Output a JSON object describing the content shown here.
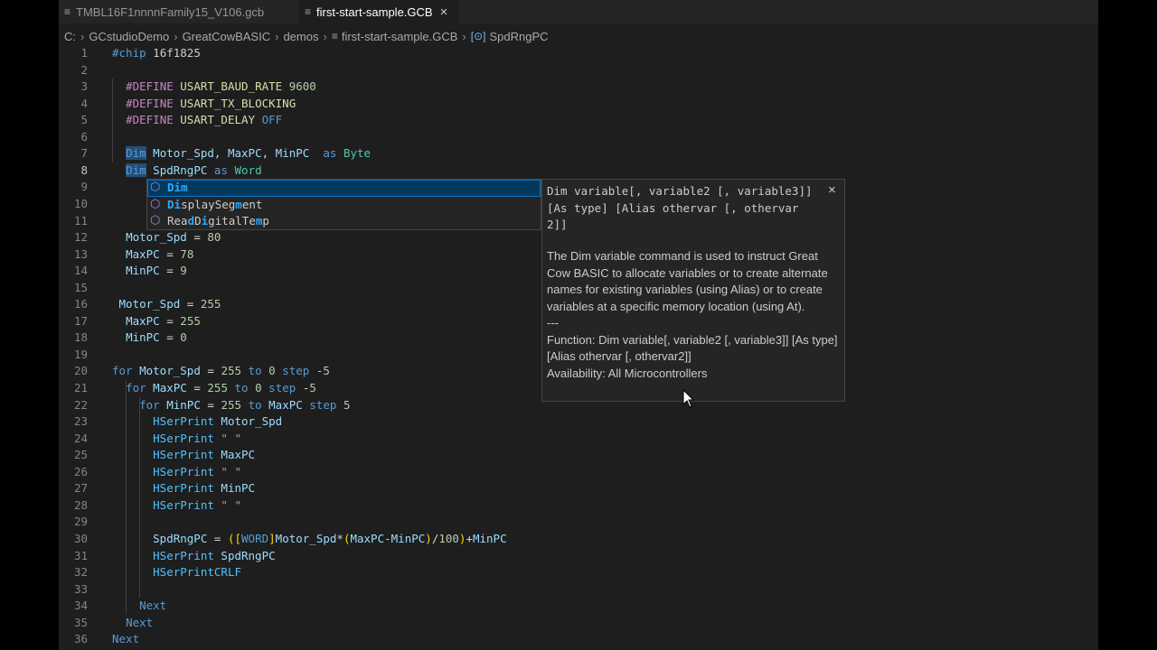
{
  "tabs": [
    {
      "label": "TMBL16F1nnnnFamily15_V106.gcb",
      "active": false
    },
    {
      "label": "first-start-sample.GCB",
      "active": true,
      "close_icon": "×"
    }
  ],
  "breadcrumb": [
    "C:",
    "GCstudioDemo",
    "GreatCowBASIC",
    "demos",
    "first-start-sample.GCB",
    "SpdRngPC"
  ],
  "code_lines": [
    {
      "n": "1",
      "text": "#chip 16f1825"
    },
    {
      "n": "2",
      "text": ""
    },
    {
      "n": "3",
      "text": "  #DEFINE USART_BAUD_RATE 9600"
    },
    {
      "n": "4",
      "text": "  #DEFINE USART_TX_BLOCKING"
    },
    {
      "n": "5",
      "text": "  #DEFINE USART_DELAY OFF"
    },
    {
      "n": "6",
      "text": ""
    },
    {
      "n": "7",
      "text": "  Dim Motor_Spd, MaxPC, MinPC  as Byte"
    },
    {
      "n": "8",
      "text": "  Dim SpdRngPC as Word"
    },
    {
      "n": "9",
      "text": ""
    },
    {
      "n": "10",
      "text": ""
    },
    {
      "n": "11",
      "text": ""
    },
    {
      "n": "12",
      "text": "  Motor_Spd = 80"
    },
    {
      "n": "13",
      "text": "  MaxPC = 78"
    },
    {
      "n": "14",
      "text": "  MinPC = 9"
    },
    {
      "n": "15",
      "text": ""
    },
    {
      "n": "16",
      "text": " Motor_Spd = 255"
    },
    {
      "n": "17",
      "text": "  MaxPC = 255"
    },
    {
      "n": "18",
      "text": "  MinPC = 0"
    },
    {
      "n": "19",
      "text": ""
    },
    {
      "n": "20",
      "text": "for Motor_Spd = 255 to 0 step -5"
    },
    {
      "n": "21",
      "text": "  for MaxPC = 255 to 0 step -5"
    },
    {
      "n": "22",
      "text": "    for MinPC = 255 to MaxPC step 5"
    },
    {
      "n": "23",
      "text": "      HSerPrint Motor_Spd"
    },
    {
      "n": "24",
      "text": "      HSerPrint \" \""
    },
    {
      "n": "25",
      "text": "      HSerPrint MaxPC"
    },
    {
      "n": "26",
      "text": "      HSerPrint \" \""
    },
    {
      "n": "27",
      "text": "      HSerPrint MinPC"
    },
    {
      "n": "28",
      "text": "      HSerPrint \" \""
    },
    {
      "n": "29",
      "text": ""
    },
    {
      "n": "30",
      "text": "      SpdRngPC = ([WORD]Motor_Spd*(MaxPC-MinPC)/100)+MinPC"
    },
    {
      "n": "31",
      "text": "      HSerPrint SpdRngPC"
    },
    {
      "n": "32",
      "text": "      HSerPrintCRLF"
    },
    {
      "n": "33",
      "text": ""
    },
    {
      "n": "34",
      "text": "    Next"
    },
    {
      "n": "35",
      "text": "  Next"
    },
    {
      "n": "36",
      "text": "Next"
    }
  ],
  "suggestions": [
    {
      "icon": "cube-icon",
      "label": "Dim",
      "selected": true
    },
    {
      "icon": "cube-icon",
      "label": "DisplaySegment",
      "selected": false
    },
    {
      "icon": "cube-icon",
      "label": "ReadDigitalTemp",
      "selected": false
    }
  ],
  "doc": {
    "signature": "Dim variable[, variable2 [, variable3]] [As type] [Alias othervar [, othervar 2]]",
    "close_icon": "×",
    "description": "The Dim variable command is used to instruct Great Cow BASIC to allocate variables or to create alternate names for existing variables (using Alias) or to create variables at a specific memory location (using At).",
    "separator": "---",
    "function": "Function: Dim variable[, variable2 [, variable3]] [As type] [Alias othervar [, othervar2]]",
    "availability": "Availability: All Microcontrollers"
  },
  "colors": {
    "editor_bg": "#1e1e1e",
    "keyword": "#569cd6",
    "number": "#b5cea8",
    "selection": "#04395e",
    "match": "#2aaaff"
  }
}
